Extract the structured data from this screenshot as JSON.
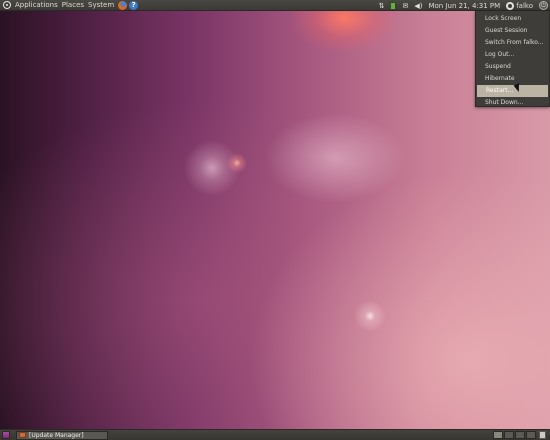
{
  "top_panel": {
    "menus": [
      {
        "label": "Applications"
      },
      {
        "label": "Places"
      },
      {
        "label": "System"
      }
    ],
    "clock": "Mon Jun 21,  4:31 PM",
    "user": "falko"
  },
  "session_menu": {
    "items": [
      {
        "label": "Lock Screen"
      },
      {
        "label": "Guest Session"
      },
      {
        "label": "Switch From falko..."
      },
      {
        "label": "Log Out..."
      },
      {
        "label": "Suspend"
      },
      {
        "label": "Hibernate"
      },
      {
        "label": "Restart...",
        "state": "highlighted"
      },
      {
        "label": "Shut Down..."
      }
    ]
  },
  "bottom_panel": {
    "task": "[Update Manager]",
    "workspaces": 4
  },
  "colors": {
    "panel": "#3b3a36",
    "menu_bg": "#3e3d39",
    "highlight": "#bbb3a4"
  },
  "icons": [
    "ubuntu-logo-icon",
    "firefox-icon",
    "help-icon",
    "network-icon",
    "battery-icon",
    "mail-icon",
    "volume-icon",
    "user-icon",
    "session-icon",
    "show-desktop-icon",
    "update-manager-icon",
    "trash-icon"
  ]
}
